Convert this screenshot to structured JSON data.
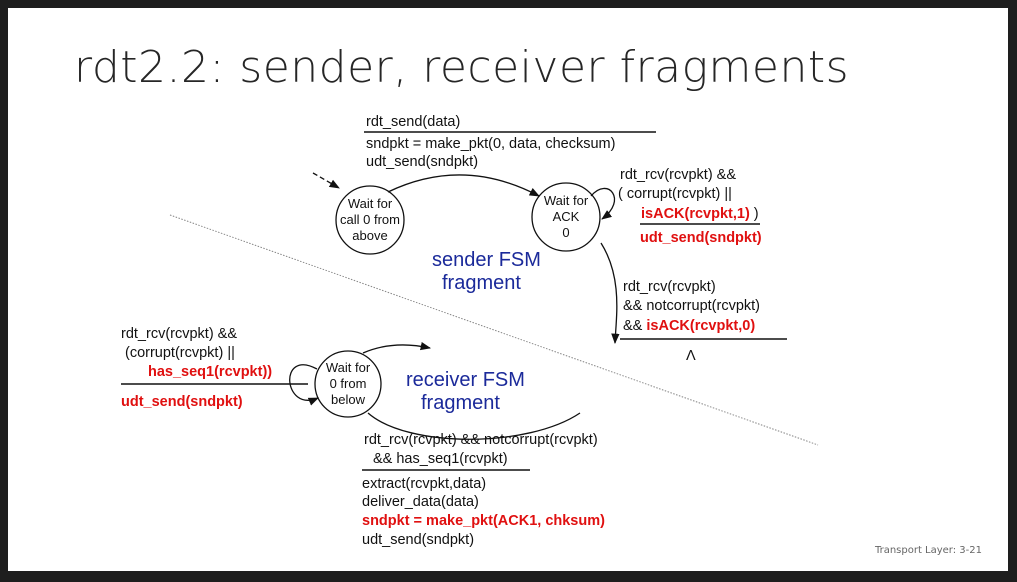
{
  "slide": {
    "title": "rdt2.2: sender, receiver fragments",
    "footer": "Transport Layer: 3-21"
  },
  "sender": {
    "fragment_label": [
      "sender FSM",
      "fragment"
    ],
    "state_wait_call": [
      "Wait for",
      "call 0 from",
      "above"
    ],
    "state_wait_ack": [
      "Wait for",
      "ACK",
      "0"
    ],
    "top_transition": {
      "event": "rdt_send(data)",
      "actions": [
        "sndpkt = make_pkt(0, data, checksum)",
        "udt_send(sndpkt)"
      ]
    },
    "self_loop": {
      "event_line1": "rdt_rcv(rcvpkt) &&",
      "event_line2": "( corrupt(rcvpkt) ||",
      "event_line3_red": "isACK(rcvpkt,1)",
      "event_line3_tail": " )",
      "action_red": "udt_send(sndpkt)"
    },
    "right_transition": {
      "event_line1": "rdt_rcv(rcvpkt)",
      "event_line2": "&& notcorrupt(rcvpkt)",
      "event_line3_prefix": "&& ",
      "event_line3_red": "isACK(rcvpkt,0)",
      "action": "Λ"
    }
  },
  "receiver": {
    "fragment_label": [
      "receiver FSM",
      "fragment"
    ],
    "state_wait_below": [
      "Wait for",
      "0 from",
      "below"
    ],
    "self_loop": {
      "event_line1": "rdt_rcv(rcvpkt) &&",
      "event_line2": "(corrupt(rcvpkt) ||",
      "event_line3_red": "has_seq1(rcvpkt))",
      "action_red": "udt_send(sndpkt)"
    },
    "bottom_transition": {
      "event_line1": "rdt_rcv(rcvpkt) && notcorrupt(rcvpkt)",
      "event_line2": "&& has_seq1(rcvpkt)",
      "actions": [
        "extract(rcvpkt,data)",
        "deliver_data(data)"
      ],
      "action_red": "sndpkt = make_pkt(ACK1, chksum)",
      "action_last": "udt_send(sndpkt)"
    }
  }
}
